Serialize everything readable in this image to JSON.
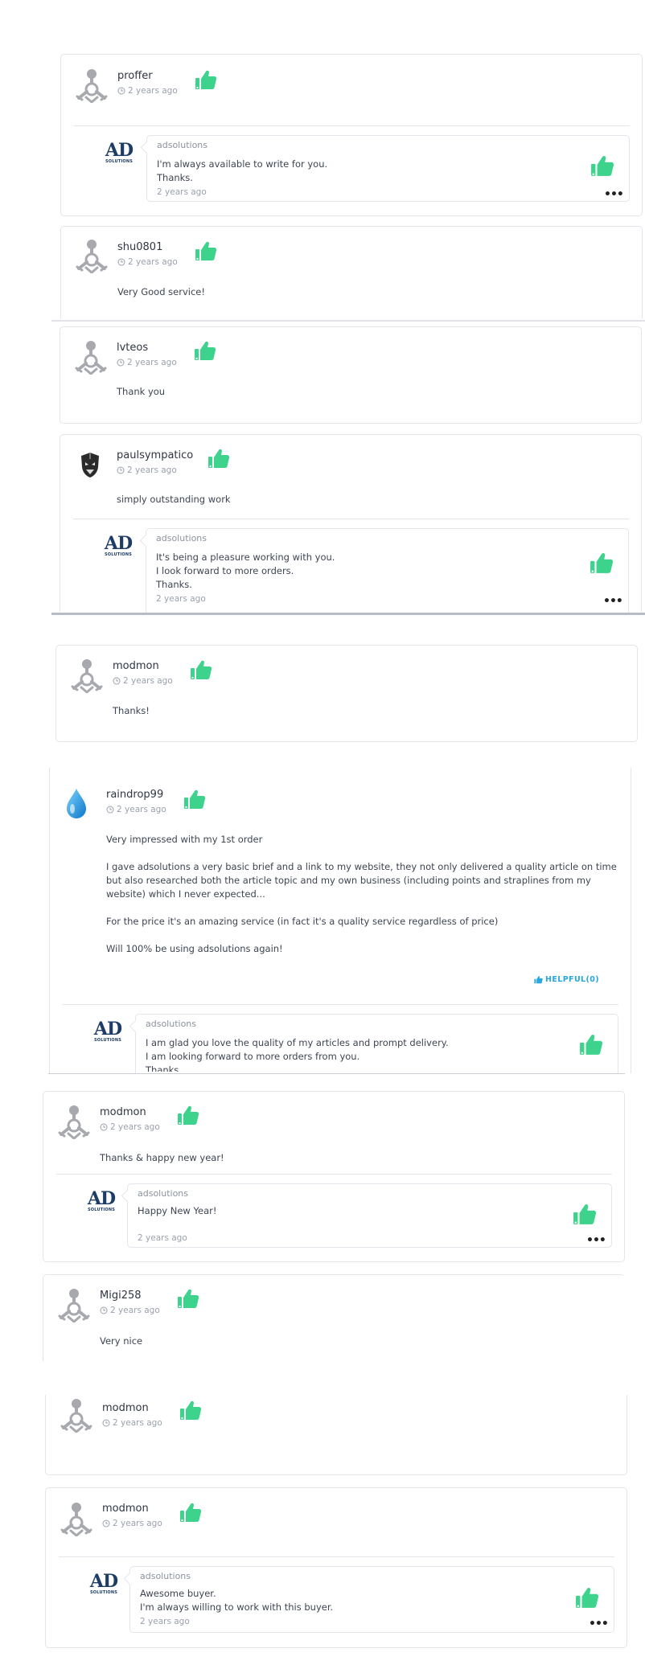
{
  "colors": {
    "thumb": "#3dd38c",
    "accent_link": "#28a7e0",
    "text": "#3b4250",
    "muted": "#9aa1ad"
  },
  "reviews": [
    {
      "author": "proffer",
      "time": "2 years ago",
      "reply": {
        "author": "adsolutions",
        "lines": [
          "I'm always available to write for you.",
          "Thanks."
        ],
        "time": "2 years ago"
      }
    },
    {
      "author": "shu0801",
      "time": "2 years ago",
      "lines": [
        "Very Good service!"
      ]
    },
    {
      "author": "lvteos",
      "time": "2 years ago",
      "lines": [
        "Thank you"
      ]
    },
    {
      "author": "paulsympatico",
      "time": "2 years ago",
      "lines": [
        "simply outstanding work"
      ],
      "reply": {
        "author": "adsolutions",
        "lines": [
          "It's being a pleasure working with you.",
          "I look forward to more orders.",
          "Thanks."
        ],
        "time": "2 years ago"
      }
    },
    {
      "author": "modmon",
      "time": "2 years ago",
      "lines": [
        "Thanks!"
      ]
    },
    {
      "author": "raindrop99",
      "time": "2 years ago",
      "lines": [
        "Very impressed with my 1st order",
        "I gave adsolutions a very basic brief and a link to my website, they not only delivered a quality article on time but also researched both the article topic and my own business (including points and straplines from my website) which I never expected...",
        "For the price it's an amazing service (in fact it's a quality service regardless of price)",
        "Will 100% be using adsolutions again!"
      ],
      "helpful": "HELPFUL(0)",
      "reply": {
        "author": "adsolutions",
        "lines": [
          "I am glad you love the quality of my articles and prompt delivery.",
          "I am looking forward to more orders from you.",
          "Thanks."
        ]
      }
    },
    {
      "author": "modmon",
      "time": "2 years ago",
      "lines": [
        "Thanks & happy new year!"
      ],
      "reply": {
        "author": "adsolutions",
        "lines": [
          "Happy New Year!"
        ],
        "time": "2 years ago"
      }
    },
    {
      "author": "Migi258",
      "time": "2 years ago",
      "lines": [
        "Very nice"
      ]
    },
    {
      "author": "modmon",
      "time": "2 years ago"
    },
    {
      "author": "modmon",
      "time": "2 years ago",
      "reply": {
        "author": "adsolutions",
        "lines": [
          "Awesome buyer.",
          "I'm always willing to work with this buyer."
        ],
        "time": "2 years ago"
      }
    }
  ],
  "logo": {
    "big": "AD",
    "small": "SOLUTIONS"
  },
  "icons": {
    "user": "default-user-icon",
    "clock": "clock-icon",
    "thumb": "thumbs-up-icon",
    "more": "more-dots-icon",
    "drop": "water-drop-icon"
  }
}
